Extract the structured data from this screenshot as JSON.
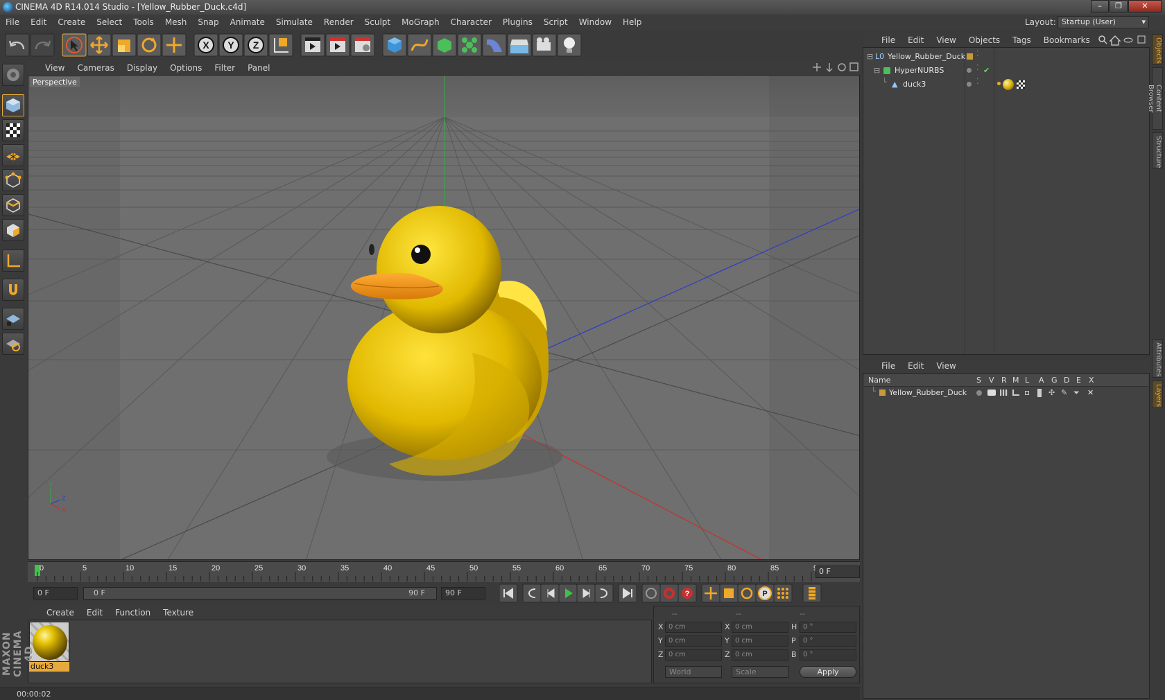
{
  "window": {
    "title": "CINEMA 4D R14.014 Studio - [Yellow_Rubber_Duck.c4d]",
    "min": "–",
    "max": "❐",
    "close": "✕"
  },
  "menubar": [
    "File",
    "Edit",
    "Create",
    "Select",
    "Tools",
    "Mesh",
    "Snap",
    "Animate",
    "Simulate",
    "Render",
    "Sculpt",
    "MoGraph",
    "Character",
    "Plugins",
    "Script",
    "Window",
    "Help"
  ],
  "layout": {
    "label": "Layout:",
    "value": "Startup (User)"
  },
  "viewport": {
    "menu": [
      "View",
      "Cameras",
      "Display",
      "Options",
      "Filter",
      "Panel"
    ],
    "label": "Perspective"
  },
  "timeline": {
    "ticks": [
      "0",
      "5",
      "10",
      "15",
      "20",
      "25",
      "30",
      "35",
      "40",
      "45",
      "50",
      "55",
      "60",
      "65",
      "70",
      "75",
      "80",
      "85",
      "90"
    ],
    "current_frame": "0 F",
    "start_field": "0 F",
    "range_start": "0 F",
    "range_end": "90 F",
    "end_field": "90 F"
  },
  "material_manager": {
    "menu": [
      "Create",
      "Edit",
      "Function",
      "Texture"
    ],
    "material_name": "duck3"
  },
  "coordinates": {
    "headers": [
      "--",
      "--",
      "--"
    ],
    "rows": [
      {
        "l1": "X",
        "v1": "0 cm",
        "l2": "X",
        "v2": "0 cm",
        "l3": "H",
        "v3": "0 °"
      },
      {
        "l1": "Y",
        "v1": "0 cm",
        "l2": "Y",
        "v2": "0 cm",
        "l3": "P",
        "v3": "0 °"
      },
      {
        "l1": "Z",
        "v1": "0 cm",
        "l2": "Z",
        "v2": "0 cm",
        "l3": "B",
        "v3": "0 °"
      }
    ],
    "mode1": "World",
    "mode2": "Scale",
    "apply": "Apply"
  },
  "status": {
    "time": "00:00:02"
  },
  "maxon": "MAXON CINEMA 4D",
  "object_manager": {
    "menu": [
      "File",
      "Edit",
      "View",
      "Objects",
      "Tags",
      "Bookmarks"
    ],
    "objects": [
      {
        "name": "Yellow_Rubber_Duck"
      },
      {
        "name": "HyperNURBS"
      },
      {
        "name": "duck3"
      }
    ]
  },
  "layer_manager": {
    "menu": [
      "File",
      "Edit",
      "View"
    ],
    "columns": [
      "Name",
      "S",
      "V",
      "R",
      "M",
      "L",
      "A",
      "G",
      "D",
      "E",
      "X"
    ],
    "layers": [
      {
        "name": "Yellow_Rubber_Duck"
      }
    ]
  },
  "side_tabs": [
    "Objects",
    "Content Browser",
    "Structure",
    "Attributes",
    "Layers"
  ],
  "colors": {
    "accent": "#e8a93c",
    "duck": "#e6c200",
    "beak": "#f29a1e"
  }
}
